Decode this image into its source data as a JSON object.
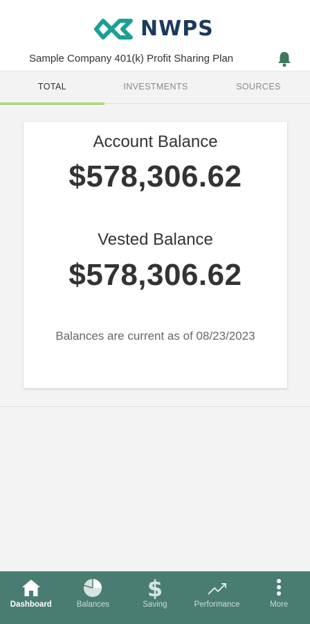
{
  "header": {
    "logo_text": "NWPS",
    "plan_name": "Sample Company 401(k) Profit Sharing Plan"
  },
  "tabs": [
    {
      "label": "TOTAL",
      "active": true
    },
    {
      "label": "INVESTMENTS",
      "active": false
    },
    {
      "label": "SOURCES",
      "active": false
    }
  ],
  "balances": {
    "account_label": "Account Balance",
    "account_amount": "$578,306.62",
    "vested_label": "Vested Balance",
    "vested_amount": "$578,306.62",
    "as_of_text": "Balances are current as of 08/23/2023"
  },
  "bottom_nav": [
    {
      "label": "Dashboard",
      "icon": "home-icon",
      "active": true
    },
    {
      "label": "Balances",
      "icon": "pie-chart-icon",
      "active": false
    },
    {
      "label": "Saving",
      "icon": "dollar-icon",
      "active": false
    },
    {
      "label": "Performance",
      "icon": "trend-up-icon",
      "active": false
    },
    {
      "label": "More",
      "icon": "more-vertical-icon",
      "active": false
    }
  ],
  "colors": {
    "accent_green": "#8dc63f",
    "nav_background": "#4a7d72",
    "logo_teal": "#1aa096",
    "logo_navy": "#1c3a5c",
    "bell_green": "#3d7a5c"
  }
}
